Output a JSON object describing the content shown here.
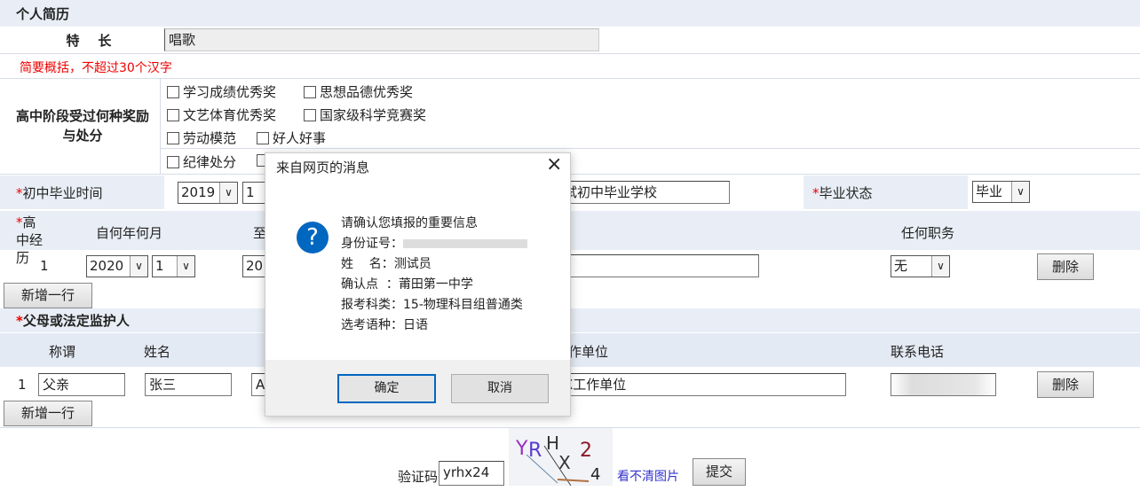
{
  "section_title": "个人简历",
  "specialty": {
    "label": "特    长",
    "value": "唱歌",
    "hint": "简要概括，不超过30个汉字"
  },
  "awards": {
    "label": "高中阶段受过何种奖励与处分",
    "options": [
      "学习成绩优秀奖",
      "思想品德优秀奖",
      "文艺体育优秀奖",
      "国家级科学竞赛奖",
      "劳动模范",
      "好人好事",
      "纪律处分"
    ]
  },
  "junior": {
    "label": "初中毕业时间",
    "year": "2019",
    "month": "1",
    "school": "试初中毕业学校",
    "status_label": "毕业状态",
    "status": "毕业"
  },
  "high_school": {
    "label": "高中经历",
    "headers": [
      "自何年何月",
      "至",
      "任何职务"
    ],
    "row": {
      "index": "1",
      "year": "2020",
      "month": "1",
      "to_year": "20",
      "position": "无",
      "delete": "删除"
    },
    "add": "新增一行"
  },
  "guardian": {
    "label": "父母或法定监护人",
    "headers": [
      "称谓",
      "姓名",
      "作单位",
      "联系电话"
    ],
    "row": {
      "index": "1",
      "relation": "父亲",
      "name": "张三",
      "third": "A",
      "work": "X工作单位",
      "delete": "删除"
    },
    "add": "新增一行"
  },
  "captcha": {
    "label": "验证码",
    "value": "yrhx24",
    "image_text": "YRHX24",
    "refresh": "看不清图片",
    "submit": "提交"
  },
  "dialog": {
    "title": "来自网页的消息",
    "close": "×",
    "heading": "请确认您填报的重要信息",
    "lines": [
      {
        "k": "身份证号：",
        "v": ""
      },
      {
        "k": "姓    名：",
        "v": "测试员"
      },
      {
        "k": "确认点  ：",
        "v": "莆田第一中学"
      },
      {
        "k": "报考科类：",
        "v": "15-物理科目组普通类"
      },
      {
        "k": "选考语种：",
        "v": "日语"
      }
    ],
    "ok": "确定",
    "cancel": "取消"
  },
  "colors": {
    "band": "#e9eef6",
    "hint": "#e00000",
    "dialog_accent": "#0067c0"
  }
}
